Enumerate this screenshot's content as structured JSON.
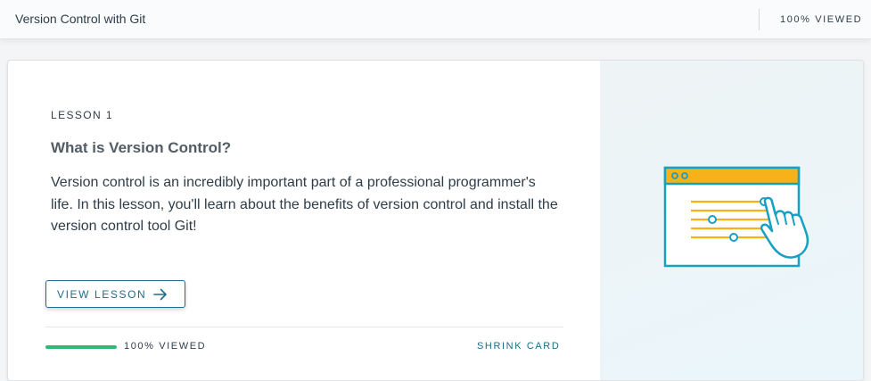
{
  "header": {
    "course_title": "Version Control with Git",
    "progress_label": "100% VIEWED"
  },
  "card": {
    "lesson_label": "LESSON 1",
    "title": "What is Version Control?",
    "description": "Version control is an incredibly important part of a professional programmer's life. In this lesson, you'll learn about the benefits of version control and install the version control tool Git!",
    "view_button_label": "VIEW LESSON",
    "progress_label": "100% VIEWED",
    "progress_fraction": 1.0,
    "shrink_label": "SHRINK CARD"
  },
  "icons": {
    "view_button_icon": "arrow-right-icon",
    "illustration": "settings-sliders-illustration"
  },
  "colors": {
    "accent": "#1c6e8a",
    "progress": "#2dbb72",
    "illustration_stroke": "#15a0c4",
    "illustration_highlight": "#f7b219"
  }
}
